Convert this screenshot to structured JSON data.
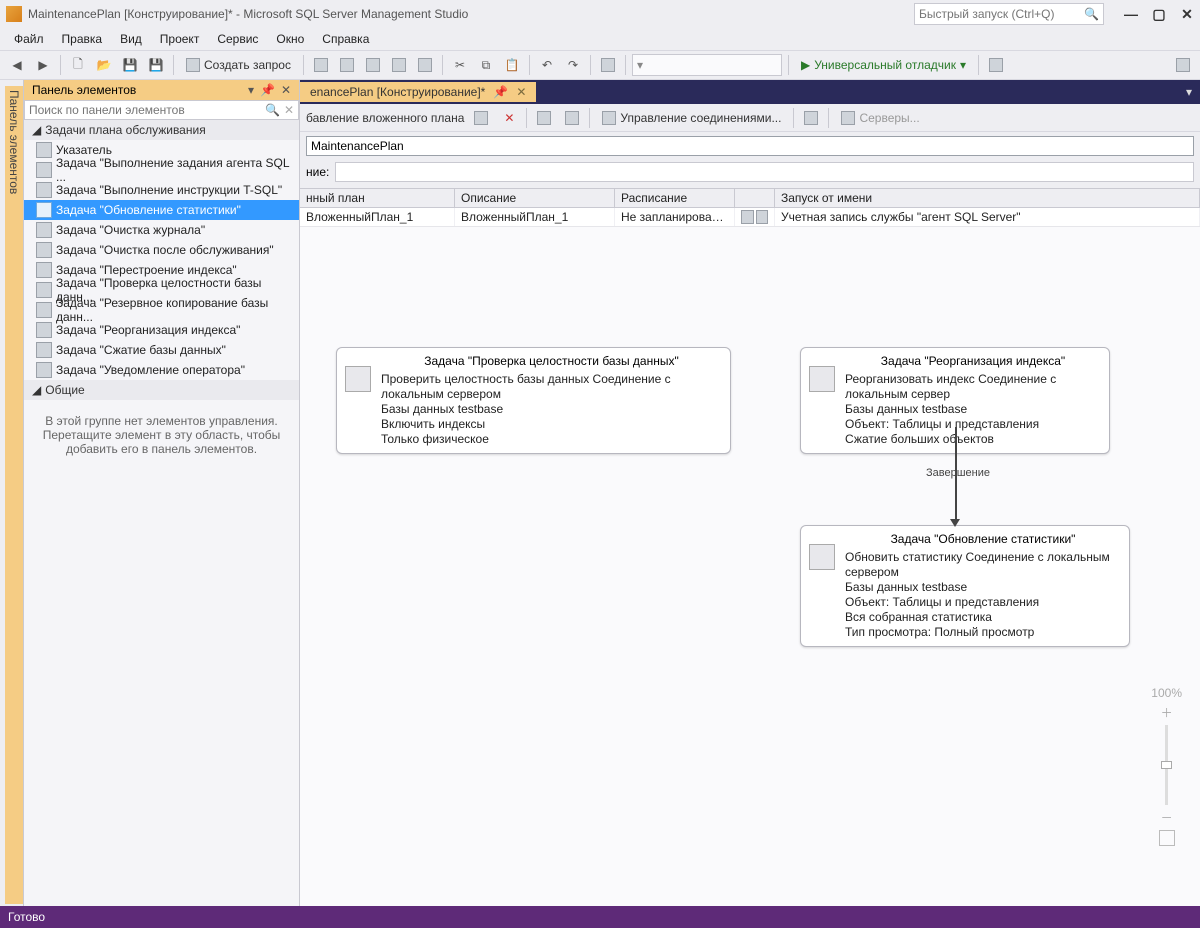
{
  "title": "MaintenancePlan [Конструирование]* - Microsoft SQL Server Management Studio",
  "quickLaunch": {
    "placeholder": "Быстрый запуск (Ctrl+Q)"
  },
  "menu": [
    "Файл",
    "Правка",
    "Вид",
    "Проект",
    "Сервис",
    "Окно",
    "Справка"
  ],
  "toolbar": {
    "createQuery": "Создать запрос",
    "debugger": "Универсальный отладчик"
  },
  "sideTab": {
    "title": "Панель элементов"
  },
  "toolbox": {
    "title": "Панель элементов",
    "searchPlaceholder": "Поиск по панели элементов",
    "group1": "Задачи плана обслуживания",
    "items": [
      "Указатель",
      "Задача \"Выполнение задания агента SQL ...",
      "Задача \"Выполнение инструкции T-SQL\"",
      "Задача \"Обновление статистики\"",
      "Задача \"Очистка журнала\"",
      "Задача \"Очистка после обслуживания\"",
      "Задача \"Перестроение индекса\"",
      "Задача \"Проверка целостности базы данн...",
      "Задача \"Резервное копирование базы данн...",
      "Задача \"Реорганизация индекса\"",
      "Задача \"Сжатие базы данных\"",
      "Задача \"Уведомление оператора\""
    ],
    "selectedIndex": 3,
    "group2": "Общие",
    "emptyMsg": "В этой группе нет элементов управления. Перетащите элемент в эту область, чтобы добавить его в панель элементов."
  },
  "docTab": "enancePlan [Конструирование]*",
  "designTools": {
    "addSub": "бавление вложенного плана",
    "manageConn": "Управление соединениями...",
    "servers": "Серверы..."
  },
  "nameField": {
    "value": "MaintenancePlan"
  },
  "descField": {
    "label": "ние:"
  },
  "grid": {
    "headers": [
      "нный план",
      "Описание",
      "Расписание",
      "",
      "Запуск от имени"
    ],
    "row": {
      "c0": "ВложенныйПлан_1",
      "c1": "ВложенныйПлан_1",
      "c2": "Не запланировано (п...",
      "c3": "Учетная запись службы \"агент SQL Server\""
    }
  },
  "nodes": {
    "integrity": {
      "title": "Задача \"Проверка целостности базы данных\"",
      "lines": [
        "Проверить целостность базы данных Соединение с локальным сервером",
        "Базы данных testbase",
        "Включить индексы",
        "Только физическое"
      ]
    },
    "reorg": {
      "title": "Задача \"Реорганизация индекса\"",
      "lines": [
        "Реорганизовать индекс Соединение с локальным сервер",
        "Базы данных testbase",
        "Объект: Таблицы и представления",
        "Сжатие больших объектов"
      ]
    },
    "updatestats": {
      "title": "Задача \"Обновление статистики\"",
      "lines": [
        "Обновить статистику Соединение с локальным сервером",
        "Базы данных testbase",
        "Объект: Таблицы и представления",
        "Вся собранная статистика",
        "Тип просмотра: Полный просмотр"
      ]
    },
    "connLabel": "Завершение"
  },
  "zoom": {
    "pct": "100%"
  },
  "status": "Готово"
}
